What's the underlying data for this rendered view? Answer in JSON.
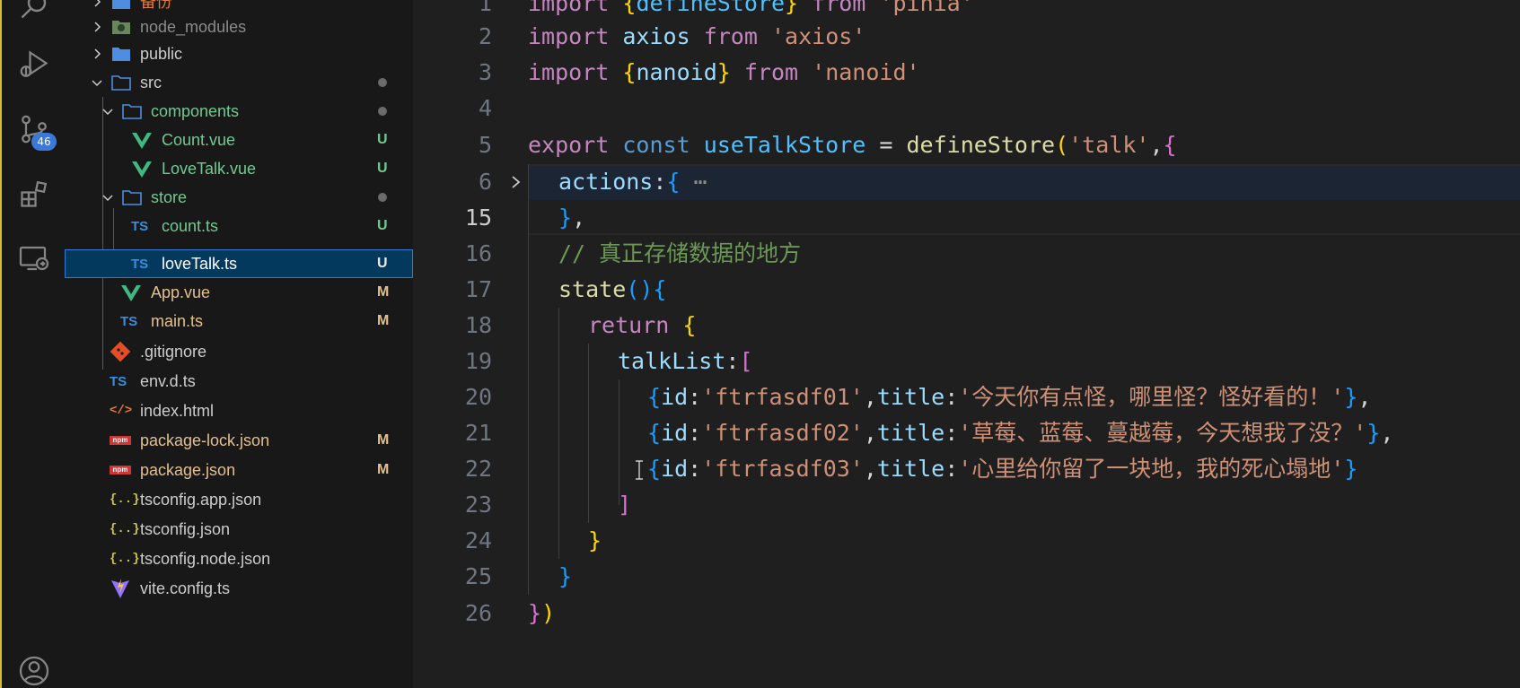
{
  "activity_bar": {
    "source_control_badge": "46",
    "accent_color": "#d7ba37"
  },
  "explorer": {
    "items": [
      {
        "label": "备份",
        "icon": "folder-icon",
        "status": "",
        "color": "#e37933"
      },
      {
        "label": "node_modules",
        "icon": "node-folder-icon",
        "status": "",
        "color": "#8b8b8b"
      },
      {
        "label": "public",
        "icon": "folder-icon",
        "status": "",
        "color": "#cccccc"
      },
      {
        "label": "src",
        "icon": "folder-open-icon",
        "status": "dot",
        "color": "#cccccc"
      },
      {
        "label": "components",
        "icon": "folder-open-icon",
        "status": "dot",
        "color": "#73c991"
      },
      {
        "label": "Count.vue",
        "icon": "vue-icon",
        "status": "U",
        "color": "#73c991"
      },
      {
        "label": "LoveTalk.vue",
        "icon": "vue-icon",
        "status": "U",
        "color": "#73c991"
      },
      {
        "label": "store",
        "icon": "folder-open-icon",
        "status": "dot",
        "color": "#73c991"
      },
      {
        "label": "count.ts",
        "icon": "ts-icon",
        "status": "U",
        "color": "#73c991"
      },
      {
        "label": "loveTalk.ts",
        "icon": "ts-icon",
        "status": "U",
        "color": "#ffffff"
      },
      {
        "label": "App.vue",
        "icon": "vue-icon",
        "status": "M",
        "color": "#e2c08d"
      },
      {
        "label": "main.ts",
        "icon": "ts-icon",
        "status": "M",
        "color": "#e2c08d"
      },
      {
        "label": ".gitignore",
        "icon": "git-icon",
        "status": "",
        "color": "#cccccc"
      },
      {
        "label": "env.d.ts",
        "icon": "ts-icon",
        "status": "",
        "color": "#cccccc"
      },
      {
        "label": "index.html",
        "icon": "html-icon",
        "status": "",
        "color": "#cccccc"
      },
      {
        "label": "package-lock.json",
        "icon": "npm-icon",
        "status": "M",
        "color": "#e2c08d"
      },
      {
        "label": "package.json",
        "icon": "npm-icon",
        "status": "M",
        "color": "#e2c08d"
      },
      {
        "label": "tsconfig.app.json",
        "icon": "json-icon",
        "status": "",
        "color": "#cccccc"
      },
      {
        "label": "tsconfig.json",
        "icon": "json-icon",
        "status": "",
        "color": "#cccccc"
      },
      {
        "label": "tsconfig.node.json",
        "icon": "json-icon",
        "status": "",
        "color": "#cccccc"
      },
      {
        "label": "vite.config.ts",
        "icon": "vite-icon",
        "status": "",
        "color": "#cccccc"
      }
    ],
    "selected": "loveTalk.ts",
    "icon_text": {
      "ts": "TS",
      "json": "{..}",
      "html": "</>",
      "npm": "npm"
    }
  },
  "editor": {
    "active_line": "15",
    "fold_ellipsis": "⋯",
    "lines": [
      {
        "no": "1",
        "text": "import {defineStore} from 'pinia'"
      },
      {
        "no": "2",
        "text": "import axios from 'axios'"
      },
      {
        "no": "3",
        "text": "import {nanoid} from 'nanoid'"
      },
      {
        "no": "4",
        "text": ""
      },
      {
        "no": "5",
        "text": "export const useTalkStore = defineStore('talk',{"
      },
      {
        "no": "6",
        "text": "  actions:{ ⋯"
      },
      {
        "no": "15",
        "text": "  },"
      },
      {
        "no": "16",
        "text": "  // 真正存储数据的地方"
      },
      {
        "no": "17",
        "text": "  state(){"
      },
      {
        "no": "18",
        "text": "    return {"
      },
      {
        "no": "19",
        "text": "      talkList:["
      },
      {
        "no": "20",
        "text": "        {id:'ftrfasdf01',title:'今天你有点怪，哪里怪？怪好看的！'},"
      },
      {
        "no": "21",
        "text": "        {id:'ftrfasdf02',title:'草莓、蓝莓、蔓越莓，今天想我了没？'},"
      },
      {
        "no": "22",
        "text": "        {id:'ftrfasdf03',title:'心里给你留了一块地，我的死心塌地'}"
      },
      {
        "no": "23",
        "text": "      ]"
      },
      {
        "no": "24",
        "text": "    }"
      },
      {
        "no": "25",
        "text": "  }"
      },
      {
        "no": "26",
        "text": "})"
      }
    ],
    "tokens": {
      "l1": [
        "import",
        " ",
        "{",
        "defineStore",
        "}",
        " ",
        "from",
        " ",
        "'pinia'"
      ],
      "l2": [
        "import",
        " ",
        "axios",
        " ",
        "from",
        " ",
        "'axios'"
      ],
      "l3": [
        "import",
        " ",
        "{",
        "nanoid",
        "}",
        " ",
        "from",
        " ",
        "'nanoid'"
      ],
      "l5": [
        "export",
        " ",
        "const",
        " ",
        "useTalkStore",
        " = ",
        "defineStore",
        "(",
        "'talk'",
        ",",
        "{"
      ],
      "l6": [
        "actions",
        ":",
        "{",
        " ⋯"
      ],
      "l15": [
        "}",
        ","
      ],
      "l16": [
        "// 真正存储数据的地方"
      ],
      "l17": [
        "state",
        "(",
        ")",
        "{"
      ],
      "l18": [
        "return",
        " ",
        "{"
      ],
      "l19": [
        "talkList",
        ":",
        "["
      ],
      "l20": [
        "{",
        "id",
        ":",
        "'ftrfasdf01'",
        ",",
        "title",
        ":",
        "'今天你有点怪，哪里怪？怪好看的！'",
        "}",
        ","
      ],
      "l21": [
        "{",
        "id",
        ":",
        "'ftrfasdf02'",
        ",",
        "title",
        ":",
        "'草莓、蓝莓、蔓越莓，今天想我了没？'",
        "}",
        ","
      ],
      "l22": [
        "{",
        "id",
        ":",
        "'ftrfasdf03'",
        ",",
        "title",
        ":",
        "'心里给你留了一块地，我的死心塌地'",
        "}"
      ],
      "l23": [
        "]"
      ],
      "l24": [
        "}"
      ],
      "l25": [
        "}"
      ],
      "l26": [
        "}",
        ")"
      ]
    }
  }
}
